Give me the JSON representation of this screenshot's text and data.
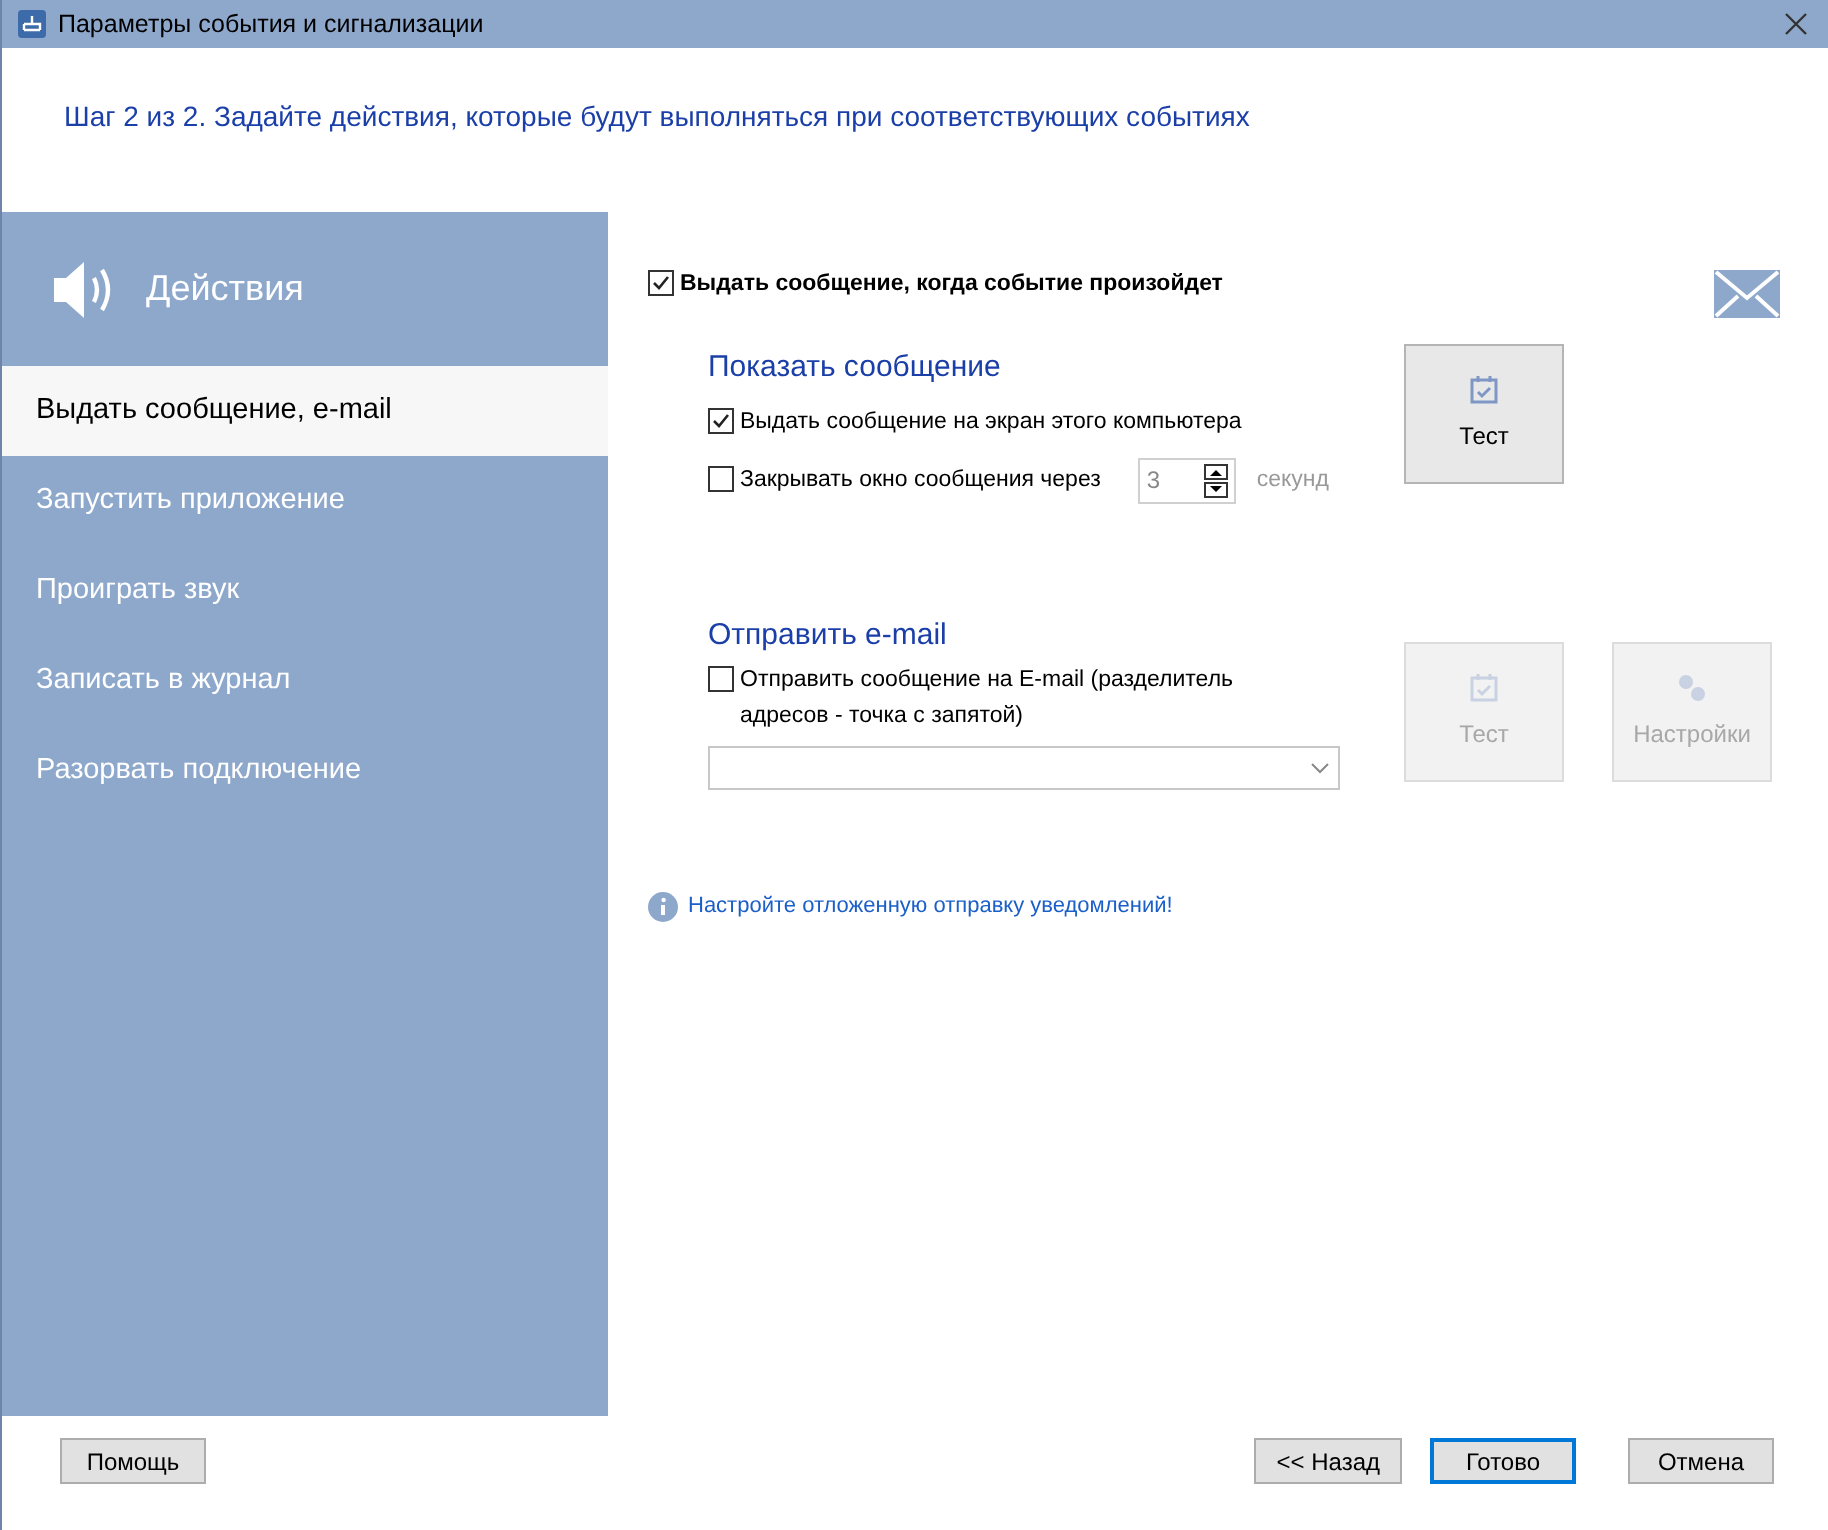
{
  "window": {
    "title": "Параметры события и сигнализации"
  },
  "step_heading": "Шаг 2 из 2. Задайте действия, которые будут выполняться при соответствующих событиях",
  "sidebar": {
    "title": "Действия",
    "items": [
      {
        "label": "Выдать сообщение, e-mail",
        "selected": true
      },
      {
        "label": "Запустить приложение",
        "selected": false
      },
      {
        "label": "Проиграть звук",
        "selected": false
      },
      {
        "label": "Записать в журнал",
        "selected": false
      },
      {
        "label": "Разорвать подключение",
        "selected": false
      }
    ]
  },
  "main_checkbox": {
    "label": "Выдать сообщение, когда событие произойдет",
    "checked": true
  },
  "show_message": {
    "heading": "Показать сообщение",
    "screen_checkbox": {
      "label": "Выдать сообщение на экран этого компьютера",
      "checked": true
    },
    "close_checkbox": {
      "label": "Закрывать окно сообщения через",
      "checked": false
    },
    "seconds_value": "3",
    "seconds_unit": "секунд",
    "test_button": {
      "label": "Тест",
      "disabled": false
    }
  },
  "send_email": {
    "heading": "Отправить e-mail",
    "email_checkbox": {
      "label": "Отправить сообщение на E-mail (разделитель адресов - точка с запятой)",
      "checked": false
    },
    "test_button": {
      "label": "Тест",
      "disabled": true
    },
    "settings_button": {
      "label": "Настройки",
      "disabled": true
    }
  },
  "info_link": "Настройте отложенную отправку уведомлений!",
  "footer_buttons": [
    {
      "label": "Помощь",
      "kind": "help",
      "selected": false
    },
    {
      "label": "<< Назад",
      "kind": "nav",
      "selected": false
    },
    {
      "label": "Готово",
      "kind": "nav",
      "selected": true
    },
    {
      "label": "Отмена",
      "kind": "nav",
      "selected": false
    }
  ]
}
